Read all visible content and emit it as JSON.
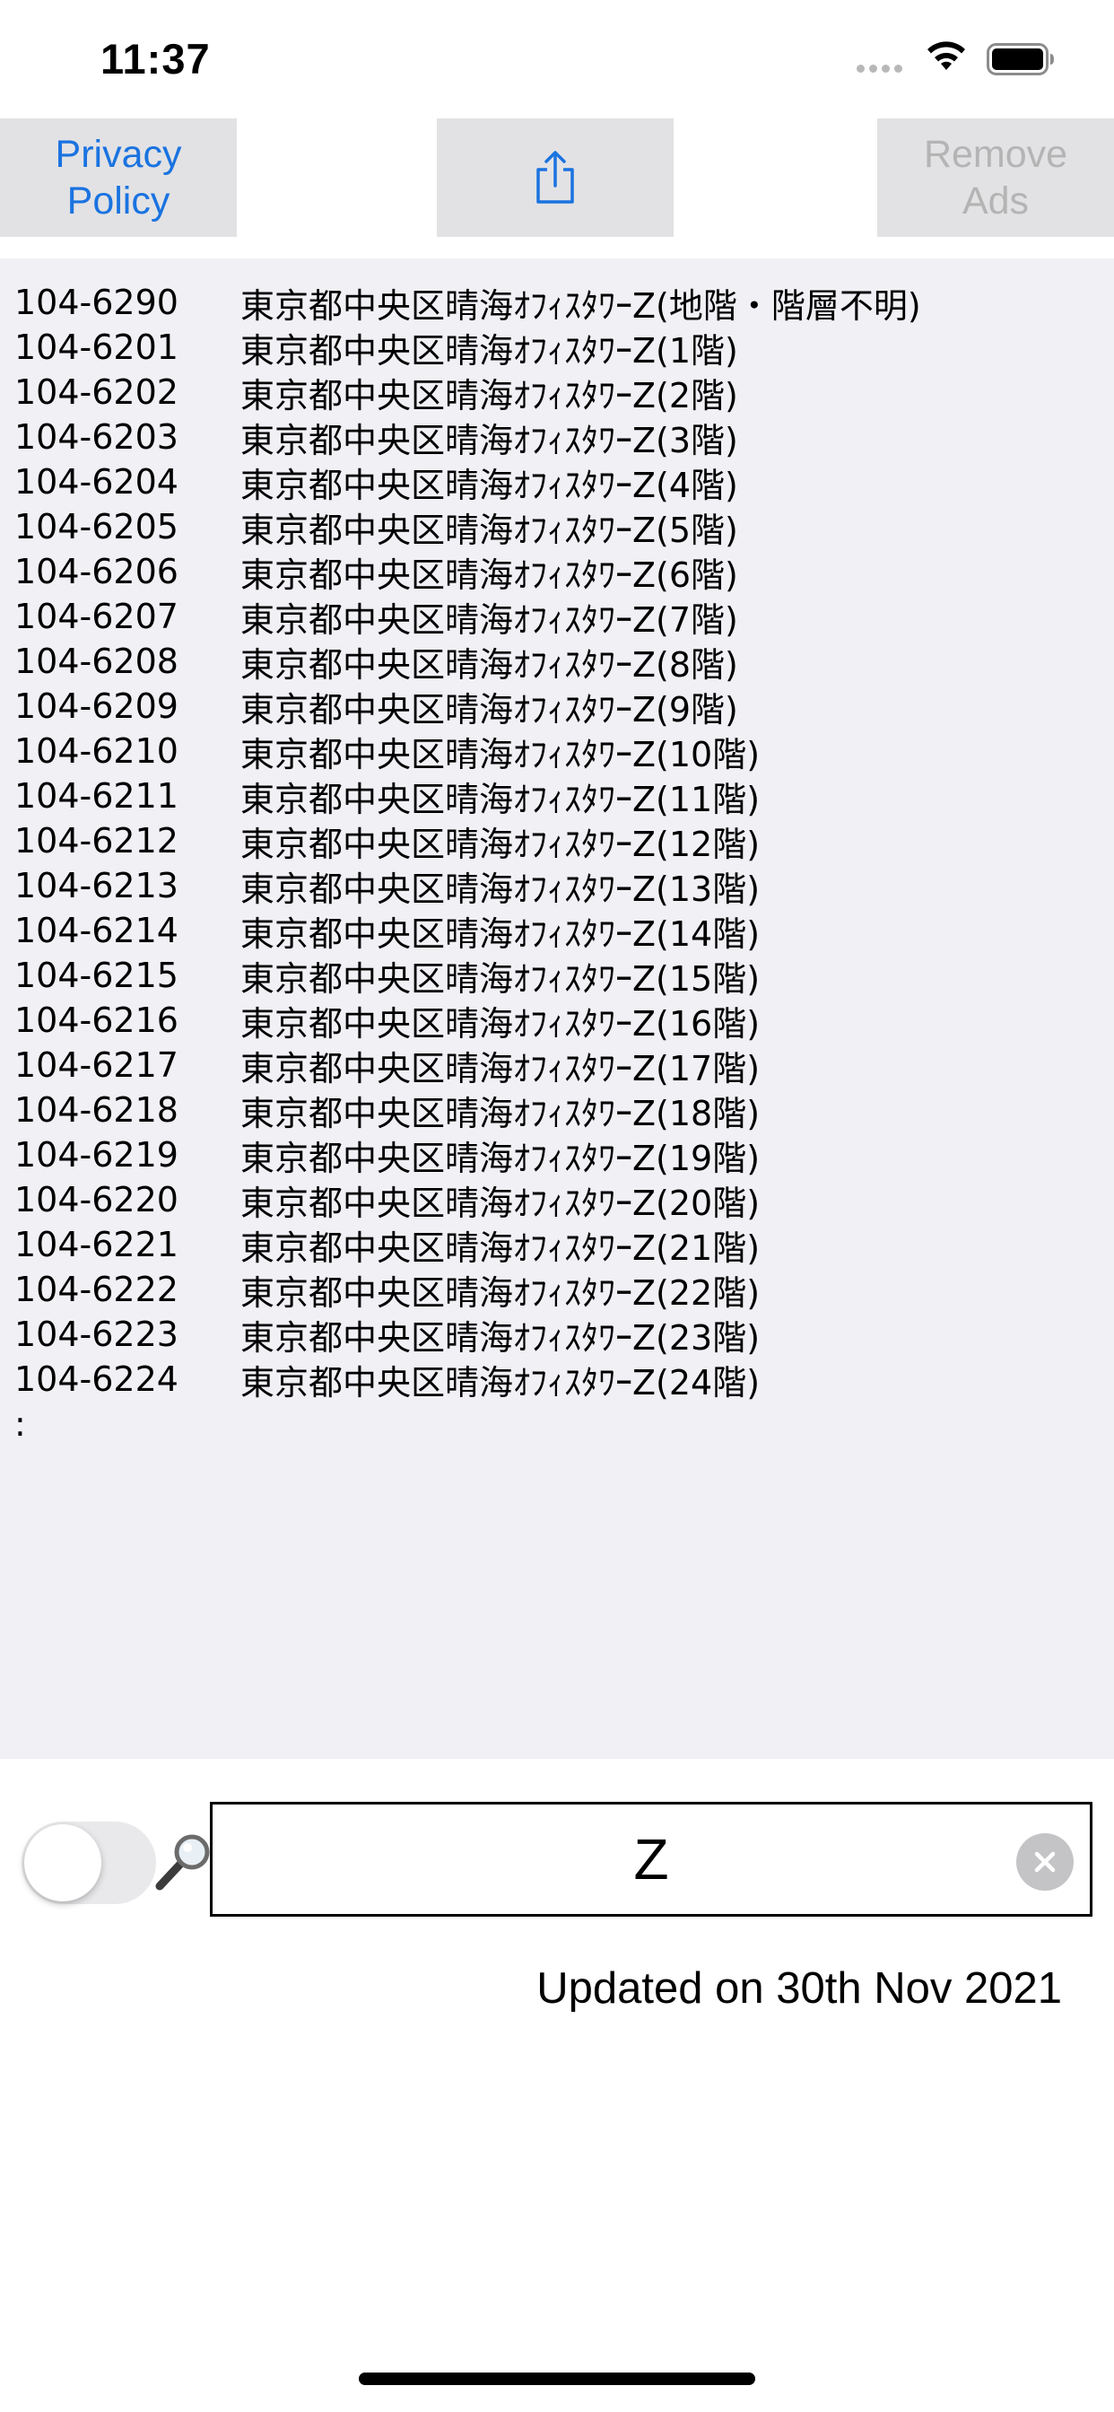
{
  "status_bar": {
    "time": "11:37",
    "icons": [
      "cellular-dots-icon",
      "wifi-icon",
      "battery-icon"
    ]
  },
  "toolbar": {
    "privacy_label": "Privacy\nPolicy",
    "share_icon": "share-icon",
    "remove_ads_label": "Remove\nAds"
  },
  "results": {
    "rows": [
      {
        "code": "104-6290",
        "address": "東京都中央区晴海ｵﾌｨｽﾀﾜｰZ(地階・階層不明)"
      },
      {
        "code": "104-6201",
        "address": "東京都中央区晴海ｵﾌｨｽﾀﾜｰZ(1階)"
      },
      {
        "code": "104-6202",
        "address": "東京都中央区晴海ｵﾌｨｽﾀﾜｰZ(2階)"
      },
      {
        "code": "104-6203",
        "address": "東京都中央区晴海ｵﾌｨｽﾀﾜｰZ(3階)"
      },
      {
        "code": "104-6204",
        "address": "東京都中央区晴海ｵﾌｨｽﾀﾜｰZ(4階)"
      },
      {
        "code": "104-6205",
        "address": "東京都中央区晴海ｵﾌｨｽﾀﾜｰZ(5階)"
      },
      {
        "code": "104-6206",
        "address": "東京都中央区晴海ｵﾌｨｽﾀﾜｰZ(6階)"
      },
      {
        "code": "104-6207",
        "address": "東京都中央区晴海ｵﾌｨｽﾀﾜｰZ(7階)"
      },
      {
        "code": "104-6208",
        "address": "東京都中央区晴海ｵﾌｨｽﾀﾜｰZ(8階)"
      },
      {
        "code": "104-6209",
        "address": "東京都中央区晴海ｵﾌｨｽﾀﾜｰZ(9階)"
      },
      {
        "code": "104-6210",
        "address": "東京都中央区晴海ｵﾌｨｽﾀﾜｰZ(10階)"
      },
      {
        "code": "104-6211",
        "address": "東京都中央区晴海ｵﾌｨｽﾀﾜｰZ(11階)"
      },
      {
        "code": "104-6212",
        "address": "東京都中央区晴海ｵﾌｨｽﾀﾜｰZ(12階)"
      },
      {
        "code": "104-6213",
        "address": "東京都中央区晴海ｵﾌｨｽﾀﾜｰZ(13階)"
      },
      {
        "code": "104-6214",
        "address": "東京都中央区晴海ｵﾌｨｽﾀﾜｰZ(14階)"
      },
      {
        "code": "104-6215",
        "address": "東京都中央区晴海ｵﾌｨｽﾀﾜｰZ(15階)"
      },
      {
        "code": "104-6216",
        "address": "東京都中央区晴海ｵﾌｨｽﾀﾜｰZ(16階)"
      },
      {
        "code": "104-6217",
        "address": "東京都中央区晴海ｵﾌｨｽﾀﾜｰZ(17階)"
      },
      {
        "code": "104-6218",
        "address": "東京都中央区晴海ｵﾌｨｽﾀﾜｰZ(18階)"
      },
      {
        "code": "104-6219",
        "address": "東京都中央区晴海ｵﾌｨｽﾀﾜｰZ(19階)"
      },
      {
        "code": "104-6220",
        "address": "東京都中央区晴海ｵﾌｨｽﾀﾜｰZ(20階)"
      },
      {
        "code": "104-6221",
        "address": "東京都中央区晴海ｵﾌｨｽﾀﾜｰZ(21階)"
      },
      {
        "code": "104-6222",
        "address": "東京都中央区晴海ｵﾌｨｽﾀﾜｰZ(22階)"
      },
      {
        "code": "104-6223",
        "address": "東京都中央区晴海ｵﾌｨｽﾀﾜｰZ(23階)"
      },
      {
        "code": "104-6224",
        "address": "東京都中央区晴海ｵﾌｨｽﾀﾜｰZ(24階)"
      }
    ],
    "more_indicator": ":"
  },
  "search": {
    "toggle_on": false,
    "query": "Z",
    "search_icon": "magnifier-icon",
    "clear_icon": "clear-icon"
  },
  "footer": {
    "updated_text": "Updated on 30th Nov 2021"
  },
  "colors": {
    "accent": "#1a73e0",
    "disabled": "#b4b4b4",
    "button_bg": "#e2e2e4",
    "results_bg": "#f0f0f5"
  }
}
